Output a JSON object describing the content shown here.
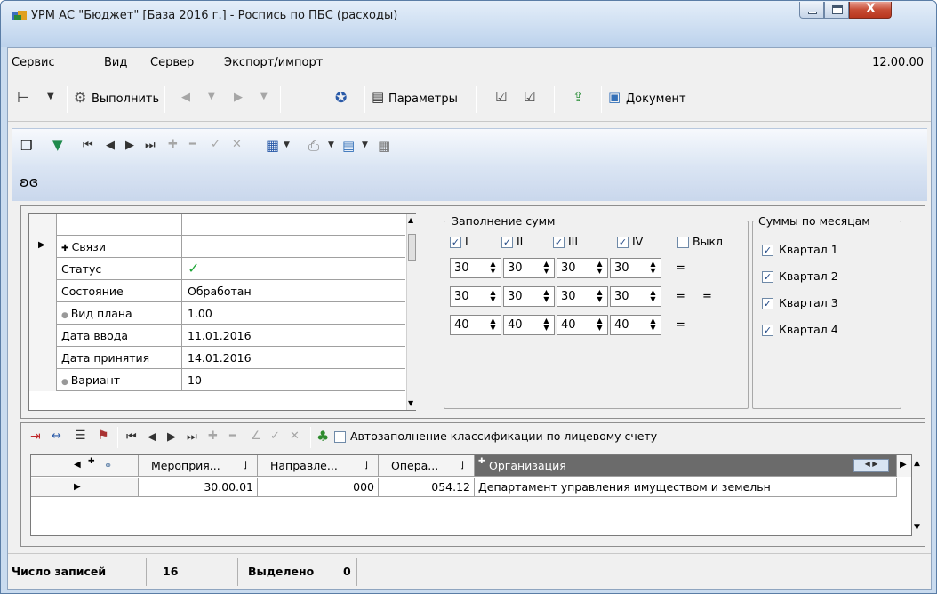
{
  "window": {
    "title": "УРМ АС \"Бюджет\" [База 2016 г.] - Роспись по ПБС (расходы)",
    "minimize": "–",
    "maximize": "□",
    "close": "X"
  },
  "menu": {
    "items": [
      "Сервис",
      "Вид",
      "Сервер",
      "Экспорт/импорт"
    ],
    "version": "12.00.00"
  },
  "toolbar": {
    "execute_label": "Выполнить",
    "params_label": "Параметры",
    "document_label": "Документ"
  },
  "form": {
    "properties": [
      {
        "name": "Связи",
        "value": ""
      },
      {
        "name": "Статус",
        "value": "✓"
      },
      {
        "name": "Состояние",
        "value": "Обработан"
      },
      {
        "name": "Вид плана",
        "value": "1.00"
      },
      {
        "name": "Дата ввода",
        "value": "11.01.2016"
      },
      {
        "name": "Дата принятия",
        "value": "14.01.2016"
      },
      {
        "name": "Вариант",
        "value": "10"
      }
    ],
    "fill_sums": {
      "title": "Заполнение сумм",
      "checks": [
        {
          "label": "I",
          "checked": true
        },
        {
          "label": "II",
          "checked": true
        },
        {
          "label": "III",
          "checked": true
        },
        {
          "label": "IV",
          "checked": true
        },
        {
          "label": "Выкл",
          "checked": false
        }
      ],
      "rows": [
        [
          "30",
          "30",
          "30",
          "30"
        ],
        [
          "30",
          "30",
          "30",
          "30"
        ],
        [
          "40",
          "40",
          "40",
          "40"
        ]
      ],
      "eq": "="
    },
    "monthly": {
      "title": "Суммы по месяцам",
      "quarters": [
        "Квартал 1",
        "Квартал 2",
        "Квартал 3",
        "Квартал 4"
      ]
    }
  },
  "lower": {
    "autofill_label": "Автозаполнение классификации по лицевому счету",
    "headers": [
      "Мероприя...",
      "Направле...",
      "Опера...",
      "Организация"
    ],
    "rows": [
      {
        "c1": "30.00.01",
        "c2": "000",
        "c3": "054.12",
        "c4": "Департамент управления имуществом и земельн"
      }
    ]
  },
  "status": {
    "records_label": "Число записей",
    "records_value": "16",
    "selected_label": "Выделено",
    "selected_value": "0"
  },
  "colors": {
    "title_bg": "#c9dbef",
    "close_red": "#c74c34",
    "check_green": "#22a83a",
    "header_dark": "#6b6b6b"
  }
}
